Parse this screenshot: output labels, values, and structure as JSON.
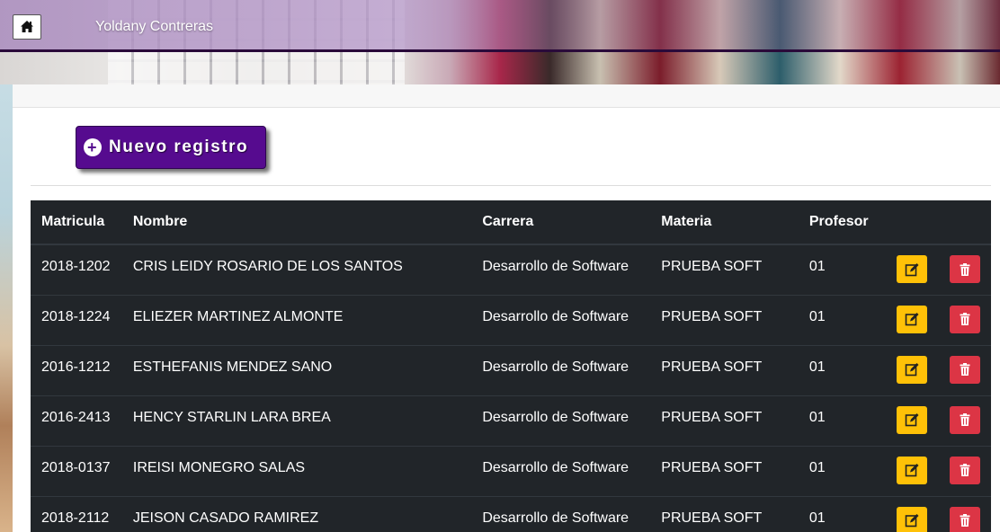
{
  "header": {
    "user_name": "Yoldany Contreras"
  },
  "toolbar": {
    "new_record_label": "Nuevo registro"
  },
  "table": {
    "columns": [
      "Matricula",
      "Nombre",
      "Carrera",
      "Materia",
      "Profesor"
    ],
    "rows": [
      {
        "matricula": "2018-1202",
        "nombre": "CRIS LEIDY ROSARIO DE LOS SANTOS",
        "carrera": "Desarrollo de Software",
        "materia": "PRUEBA SOFT",
        "profesor": "01"
      },
      {
        "matricula": "2018-1224",
        "nombre": "ELIEZER MARTINEZ ALMONTE",
        "carrera": "Desarrollo de Software",
        "materia": "PRUEBA SOFT",
        "profesor": "01"
      },
      {
        "matricula": "2016-1212",
        "nombre": "ESTHEFANIS MENDEZ SANO",
        "carrera": "Desarrollo de Software",
        "materia": "PRUEBA SOFT",
        "profesor": "01"
      },
      {
        "matricula": "2016-2413",
        "nombre": "HENCY STARLIN LARA BREA",
        "carrera": "Desarrollo de Software",
        "materia": "PRUEBA SOFT",
        "profesor": "01"
      },
      {
        "matricula": "2018-0137",
        "nombre": "IREISI MONEGRO SALAS",
        "carrera": "Desarrollo de Software",
        "materia": "PRUEBA SOFT",
        "profesor": "01"
      },
      {
        "matricula": "2018-2112",
        "nombre": "JEISON CASADO RAMIREZ",
        "carrera": "Desarrollo de Software",
        "materia": "PRUEBA SOFT",
        "profesor": "01"
      }
    ]
  },
  "icons": {
    "home": "home-icon",
    "new": "plus-circle-icon",
    "edit": "edit-icon",
    "delete": "trash-icon"
  },
  "colors": {
    "primary_button": "#560b8f",
    "table_bg": "#212529",
    "edit_button": "#ffc107",
    "delete_button": "#dc3545",
    "header_rule": "#2a0a3a"
  }
}
